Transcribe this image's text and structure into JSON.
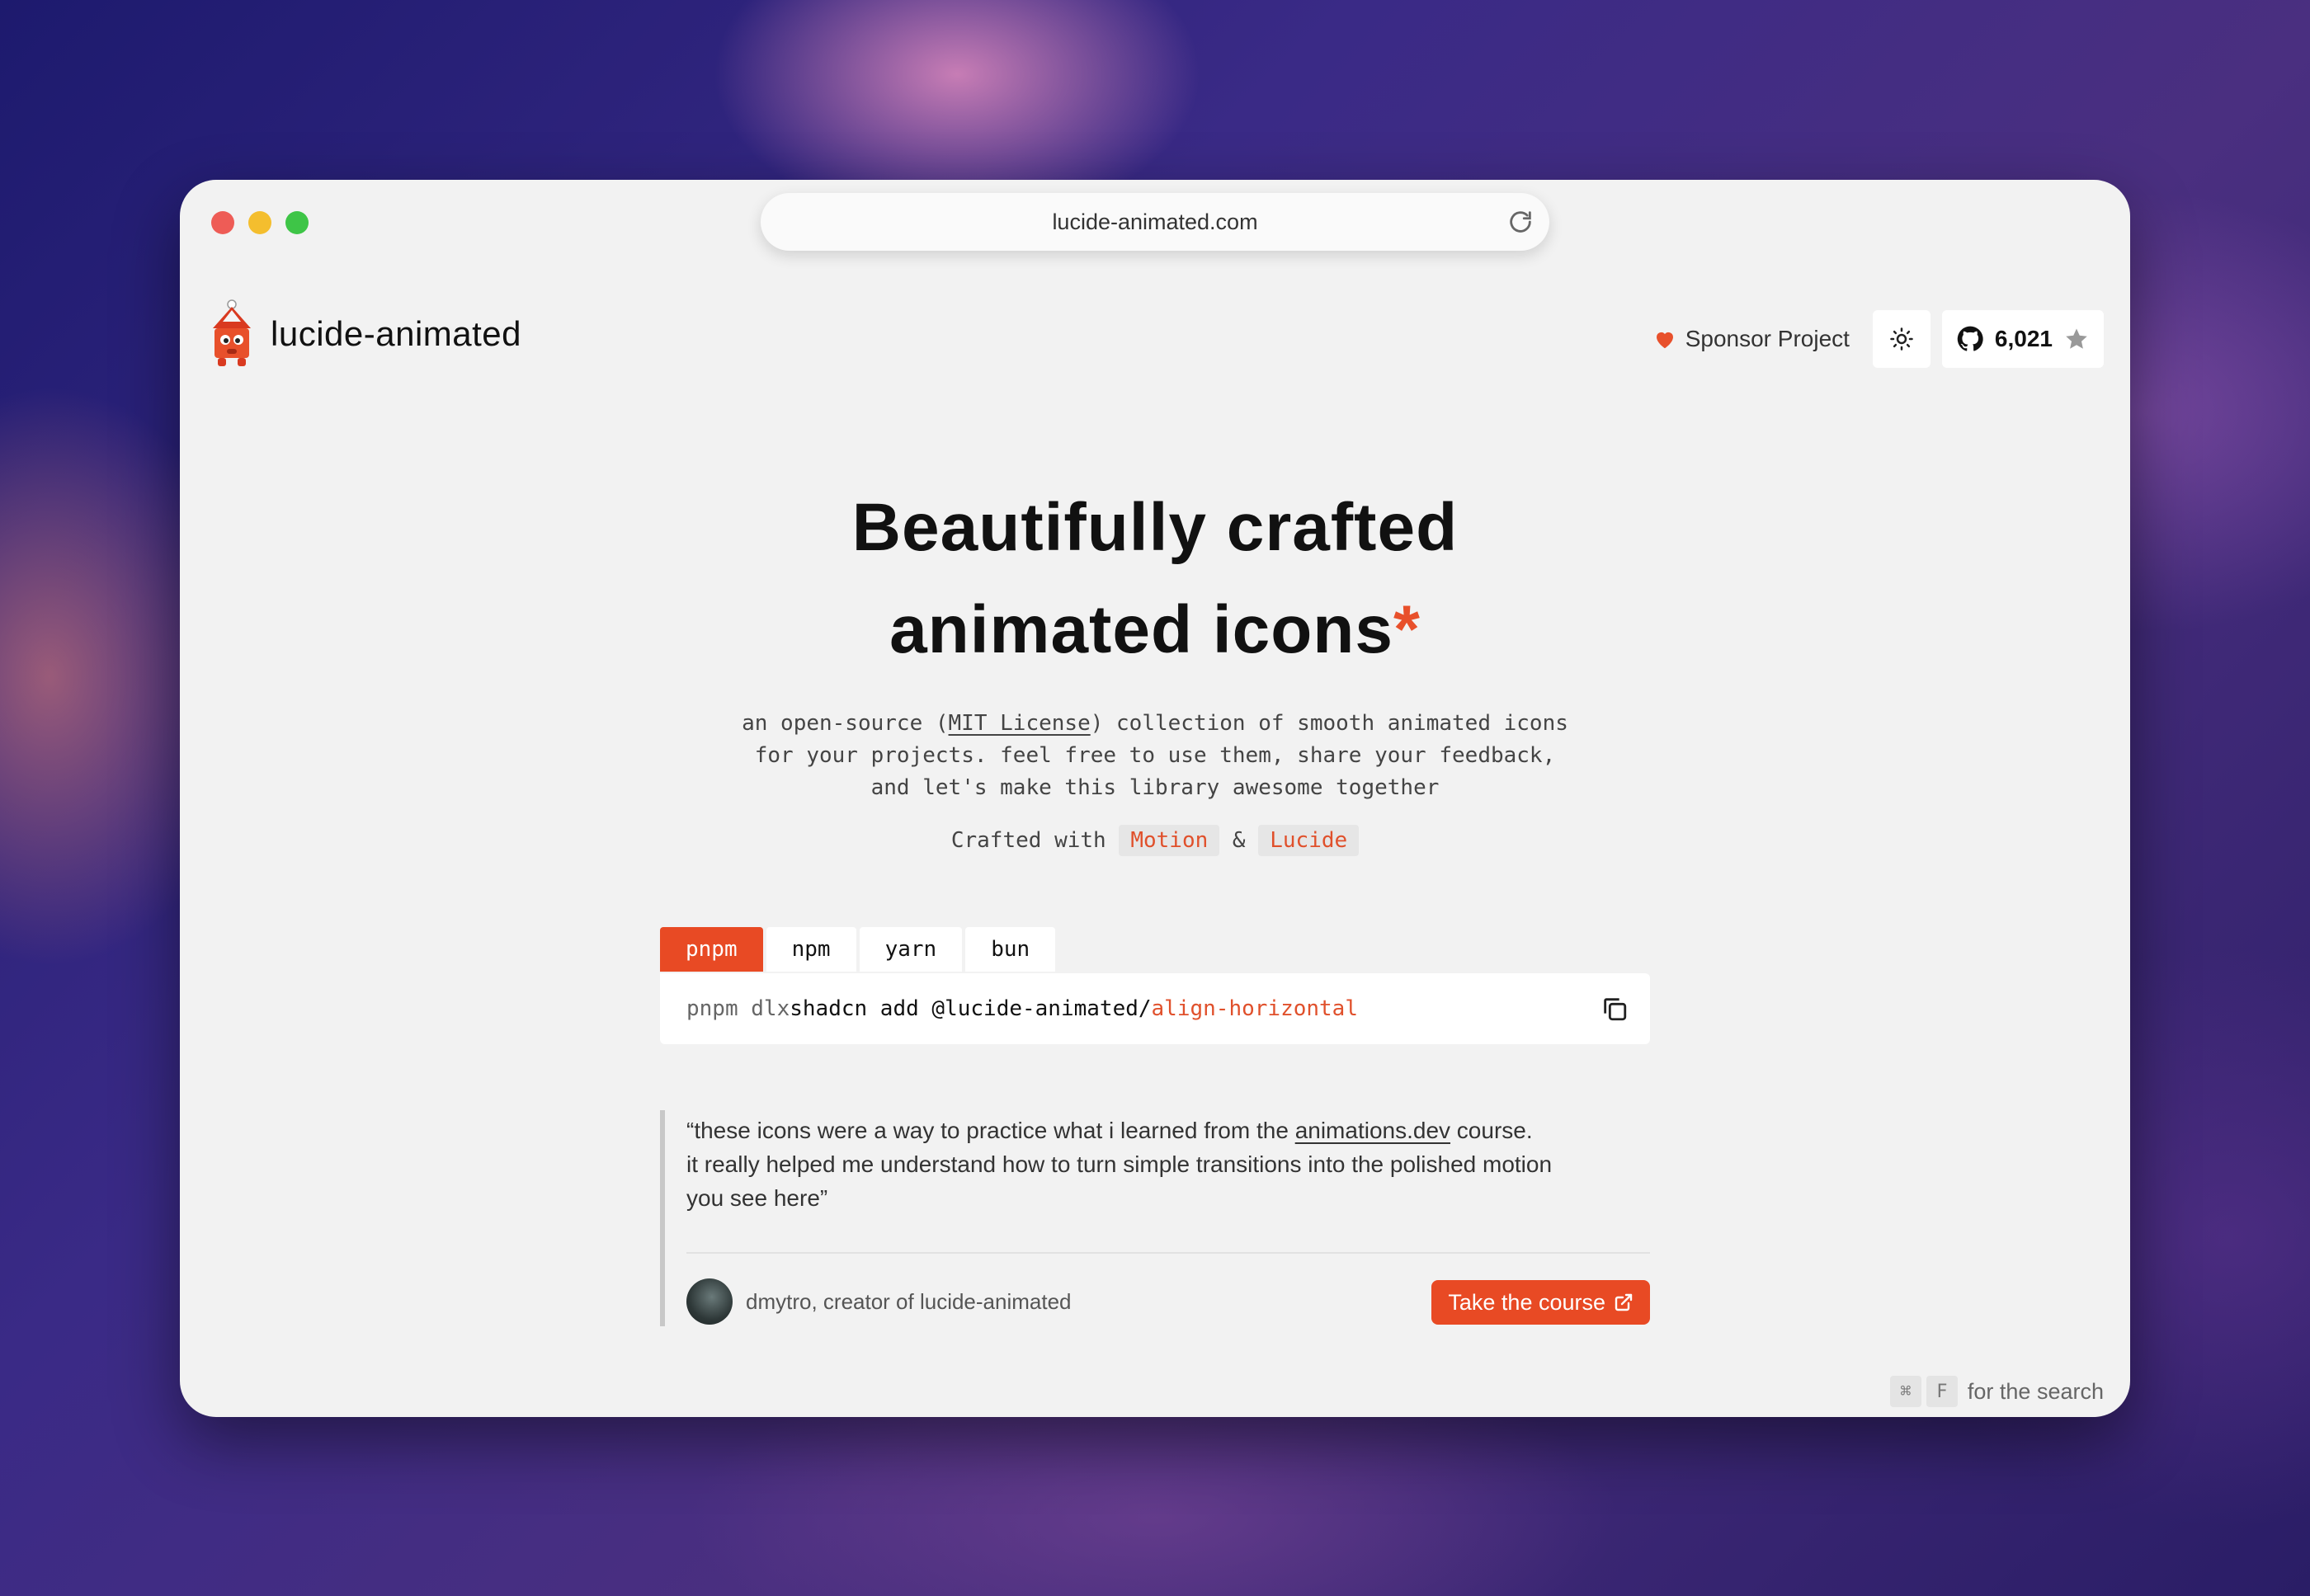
{
  "browser": {
    "url": "lucide-animated.com"
  },
  "header": {
    "brand_name": "lucide-animated",
    "sponsor_label": "Sponsor Project",
    "github_stars": "6,021"
  },
  "hero": {
    "title_line1": "Beautifully crafted",
    "title_line2": "animated icons",
    "title_mark": "*",
    "sub_line1_a": "an open-source (",
    "sub_line1_link": "MIT License",
    "sub_line1_b": ") collection of smooth animated icons",
    "sub_line2": "for your projects. feel free to use them, share your feedback,",
    "sub_line3": "and let's make this library awesome together",
    "crafted_prefix": "Crafted with",
    "crafted_lib1": "Motion",
    "crafted_amp": "&",
    "crafted_lib2": "Lucide"
  },
  "install": {
    "tabs": [
      {
        "label": "pnpm"
      },
      {
        "label": "npm"
      },
      {
        "label": "yarn"
      },
      {
        "label": "bun"
      }
    ],
    "active_tab": "pnpm",
    "cmd_runner": "pnpm dlx",
    "cmd_main": "shadcn add @lucide-animated/",
    "cmd_icon": "align-horizontal"
  },
  "quote": {
    "line1_a": "“these icons were a way to practice what i learned from the ",
    "line1_link": "animations.dev",
    "line1_b": " course.",
    "line2": "it really helped me understand how to turn simple transitions into the polished motion",
    "line3": "you see here”",
    "author": "dmytro, creator of lucide-animated",
    "cta_label": "Take the course"
  },
  "search_hint": {
    "key1": "⌘",
    "key2": "F",
    "text": "for the search"
  },
  "colors": {
    "accent": "#e84a24",
    "window_bg": "#f2f2f2"
  },
  "icons": [
    "reload-icon",
    "house-logo-icon",
    "heart-icon",
    "sun-icon",
    "github-icon",
    "star-icon",
    "copy-icon",
    "external-link-icon"
  ]
}
